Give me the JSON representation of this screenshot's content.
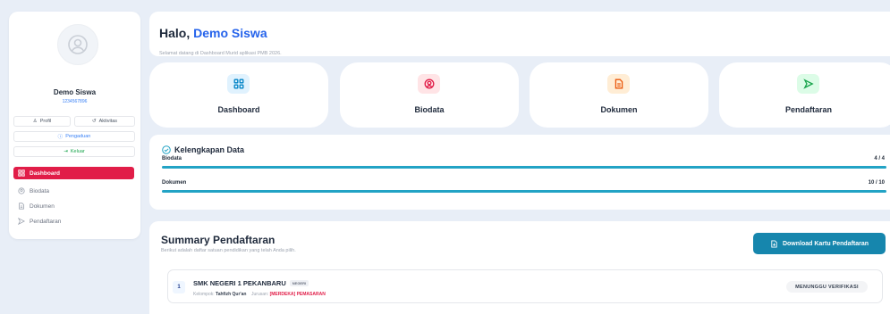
{
  "sidebar": {
    "user_name": "Demo Siswa",
    "user_id": "1234567896",
    "buttons": {
      "profil": "Profil",
      "aktivitas": "Aktivitas",
      "pengaduan": "Pengaduan",
      "keluar": "Keluar"
    },
    "nav": [
      {
        "label": "Dashboard",
        "icon": "grid-icon",
        "active": true
      },
      {
        "label": "Biodata",
        "icon": "user-circle-icon",
        "active": false
      },
      {
        "label": "Dokumen",
        "icon": "file-icon",
        "active": false
      },
      {
        "label": "Pendaftaran",
        "icon": "send-icon",
        "active": false
      }
    ]
  },
  "greeting": {
    "prefix": "Halo,",
    "name": "Demo Siswa",
    "subtitle": "Selamat datang di Dashboard Murid aplikasi PMB 2026."
  },
  "cards": [
    {
      "label": "Dashboard",
      "icon": "grid-icon",
      "bg": "#e0f2fe",
      "fg": "#0284c7"
    },
    {
      "label": "Biodata",
      "icon": "user-circle-icon",
      "bg": "#ffe4e6",
      "fg": "#e11d48"
    },
    {
      "label": "Dokumen",
      "icon": "file-icon",
      "bg": "#ffedd5",
      "fg": "#ea580c"
    },
    {
      "label": "Pendaftaran",
      "icon": "send-icon",
      "bg": "#dcfce7",
      "fg": "#16a34a"
    }
  ],
  "kelengkapan": {
    "title": "Kelengkapan Data",
    "items": [
      {
        "label": "Biodata",
        "count": "4 / 4",
        "progress": 1.0
      },
      {
        "label": "Dokumen",
        "count": "10 / 10",
        "progress": 1.0
      }
    ]
  },
  "summary": {
    "title": "Summary Pendaftaran",
    "subtitle": "Berikut adalah daftar satuan pendidikan yang telah Anda pilih.",
    "download_label": "Download Kartu Pendaftaran",
    "schools": [
      {
        "number": "1",
        "name": "SMK NEGERI 1 PEKANBARU",
        "badge": "NEGERI",
        "kelompok_label": "Kelompok:",
        "kelompok": "Tahfizh Qur'an",
        "jurusan_label": "Jurusan:",
        "jurusan": "[MERDEKA] PEMASARAN",
        "status": "MENUNGGU VERIFIKASI"
      }
    ]
  },
  "colors": {
    "accent_red": "#e11d48",
    "accent_blue": "#2563eb",
    "progress": "#22a3c5",
    "download": "#1686ad"
  }
}
